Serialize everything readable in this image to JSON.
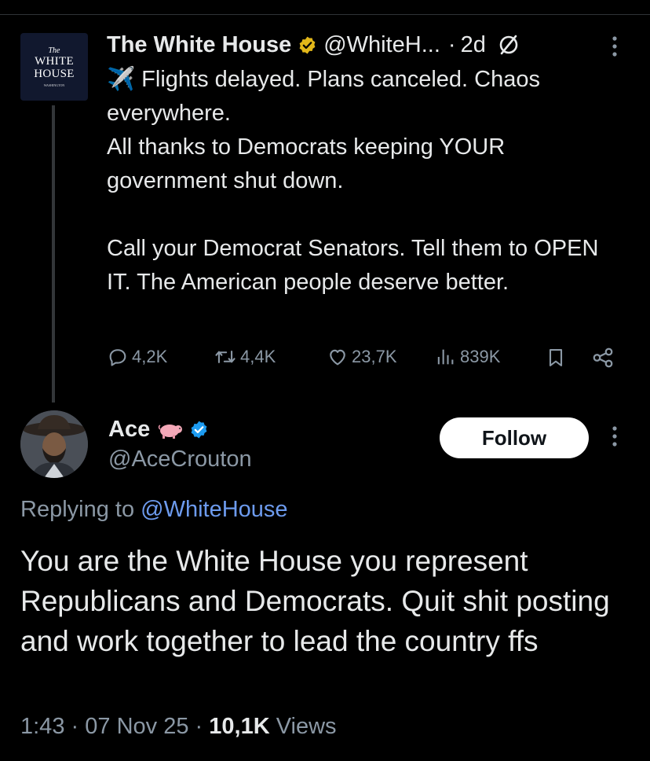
{
  "original_tweet": {
    "avatar": {
      "line1": "The",
      "line2": "WHITE",
      "line3": "HOUSE",
      "line4": "WASHINGTON"
    },
    "display_name": "The White House",
    "handle": "@WhiteH...",
    "separator": "·",
    "age": "2d",
    "text_line1": "✈️ Flights delayed. Plans canceled. Chaos everywhere.",
    "text_line2": "All thanks to Democrats keeping YOUR government shut down.",
    "text_line3": "Call your Democrat Senators. Tell them to OPEN IT. The American people deserve better.",
    "replies": "4,2K",
    "reposts": "4,4K",
    "likes": "23,7K",
    "views": "839K"
  },
  "reply": {
    "display_name": "Ace",
    "handle": "@AceCrouton",
    "follow_label": "Follow",
    "replying_prefix": "Replying to",
    "replying_to": "@WhiteHouse",
    "text": "You are the White House you represent Republicans and Democrats. Quit shit posting and work together to lead the country ffs",
    "time": "1:43",
    "sep": "·",
    "date": "07 Nov 25",
    "views_count": "10,1K",
    "views_label": "Views"
  },
  "colors": {
    "background": "#000000",
    "text": "#e7e9ea",
    "muted": "#8b98a5",
    "mention": "#6d9bee",
    "verified_gold": "#e2b719",
    "verified_blue": "#1d9bf0"
  }
}
